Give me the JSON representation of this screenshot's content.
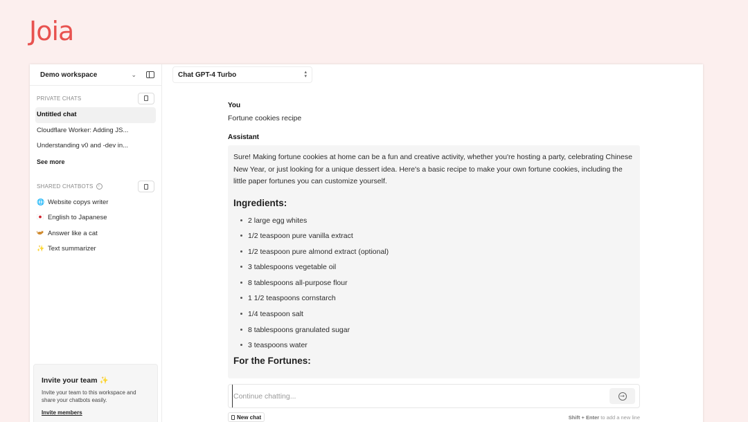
{
  "brand": {
    "logo_text": "Joia",
    "accent": "#e8524f"
  },
  "sidebar": {
    "workspace_name": "Demo workspace",
    "chevron_glyph": "⌄",
    "private_chats": {
      "title": "PRIVATE CHATS",
      "items": [
        {
          "label": "Untitled chat",
          "active": true
        },
        {
          "label": "Cloudflare Worker: Adding JS..."
        },
        {
          "label": "Understanding v0 and -dev in..."
        }
      ],
      "see_more": "See more"
    },
    "shared_chatbots": {
      "title": "SHARED CHATBOTS",
      "info_glyph": "i",
      "items": [
        {
          "icon": "🌐",
          "icon_name": "globe-icon",
          "label": "Website copys writer"
        },
        {
          "icon": "🇯🇵",
          "icon_name": "japan-flag-icon",
          "label": "English to Japanese"
        },
        {
          "icon": "🐈",
          "icon_name": "cat-icon",
          "label": "Answer like a cat"
        },
        {
          "icon": "✨",
          "icon_name": "sparkles-icon",
          "label": "Text summarizer"
        }
      ]
    },
    "invite": {
      "title": "Invite your team",
      "spark": "✨",
      "body": "Invite your team to this workspace and share your chatbots easily.",
      "link": "Invite members"
    }
  },
  "main": {
    "model": {
      "value": "Chat GPT-4 Turbo",
      "arrows": "⌃⌄"
    },
    "user_label": "You",
    "user_message": "Fortune cookies recipe",
    "assistant_label": "Assistant",
    "assistant": {
      "intro": "Sure! Making fortune cookies at home can be a fun and creative activity, whether you're hosting a party, celebrating Chinese New Year, or just looking for a unique dessert idea. Here's a basic recipe to make your own fortune cookies, including the little paper fortunes you can customize yourself.",
      "ingredients_heading": "Ingredients:",
      "ingredients": [
        "2 large egg whites",
        "1/2 teaspoon pure vanilla extract",
        "1/2 teaspoon pure almond extract (optional)",
        "3 tablespoons vegetable oil",
        "8 tablespoons all-purpose flour",
        "1 1/2 teaspoons cornstarch",
        "1/4 teaspoon salt",
        "8 tablespoons granulated sugar",
        "3 teaspoons water"
      ],
      "fortunes_heading": "For the Fortunes:"
    },
    "input": {
      "placeholder": "Continue chatting...",
      "value": ""
    },
    "send_glyph": "→",
    "new_chat_label": "New chat",
    "hint_keys": "Shift + Enter",
    "hint_text": "to add a new line"
  }
}
